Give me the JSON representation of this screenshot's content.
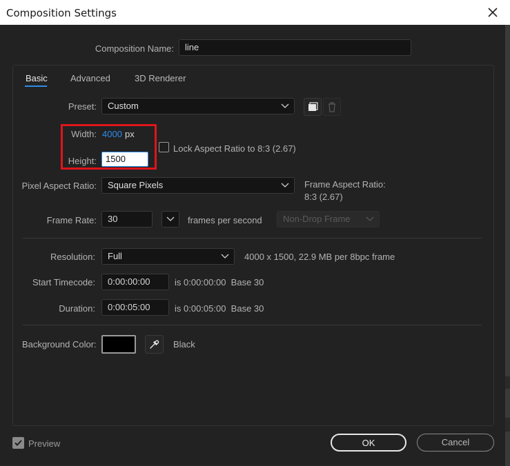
{
  "window": {
    "title": "Composition Settings"
  },
  "comp_name": {
    "label": "Composition Name:",
    "value": "line"
  },
  "tabs": [
    {
      "label": "Basic"
    },
    {
      "label": "Advanced"
    },
    {
      "label": "3D Renderer"
    }
  ],
  "preset": {
    "label": "Preset:",
    "value": "Custom"
  },
  "width": {
    "label": "Width:",
    "value": "4000",
    "unit": "px"
  },
  "height": {
    "label": "Height:",
    "value": "1500"
  },
  "lock_aspect": {
    "label": "Lock Aspect Ratio to 8:3 (2.67)",
    "checked": false
  },
  "pixel_aspect": {
    "label": "Pixel Aspect Ratio:",
    "value": "Square Pixels"
  },
  "frame_aspect": {
    "line1": "Frame Aspect Ratio:",
    "line2": "8:3 (2.67)"
  },
  "frame_rate": {
    "label": "Frame Rate:",
    "value": "30",
    "unit": "frames per second",
    "drop_frame": "Non-Drop Frame"
  },
  "resolution": {
    "label": "Resolution:",
    "value": "Full",
    "info": "4000 x 1500, 22.9 MB per 8bpc frame"
  },
  "start_timecode": {
    "label": "Start Timecode:",
    "value": "0:00:00:00",
    "info": "is 0:00:00:00  Base 30"
  },
  "duration": {
    "label": "Duration:",
    "value": "0:00:05:00",
    "info": "is 0:00:05:00  Base 30"
  },
  "background": {
    "label": "Background Color:",
    "swatch": "#000000",
    "name": "Black"
  },
  "preview": {
    "label": "Preview",
    "checked": true
  },
  "buttons": {
    "ok": "OK",
    "cancel": "Cancel"
  },
  "colors": {
    "accent": "#2d8ceb",
    "highlight": "#e0151b"
  }
}
